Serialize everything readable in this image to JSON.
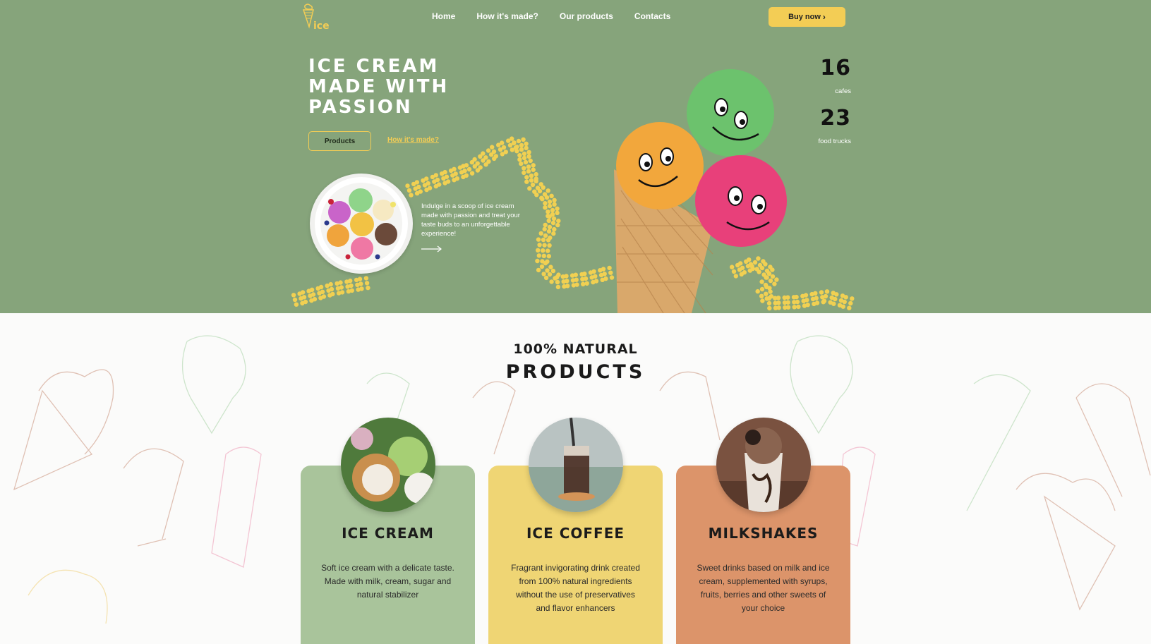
{
  "header": {
    "logo_text": "ice",
    "nav": [
      "Home",
      "How it's made?",
      "Our products",
      "Contacts"
    ],
    "buy_label": "Buy now",
    "buy_icon": "chevron-right-icon"
  },
  "hero": {
    "headline": [
      "ICE CREAM",
      "MADE WITH",
      "PASSION"
    ],
    "products_button": "Products",
    "how_link": "How it's made?",
    "intro_text": "Indulge in a scoop of ice cream made with passion and treat your taste buds to an unforgettable experience!",
    "stats": [
      {
        "value": "16",
        "label": "cafes"
      },
      {
        "value": "23",
        "label": "food trucks"
      }
    ]
  },
  "products": {
    "subtitle": "100% NATURAL",
    "title": "PRODUCTS",
    "cards": [
      {
        "title": "ICE CREAM",
        "desc": "Soft ice cream with a delicate taste. Made with milk, cream, sugar and natural stabilizer"
      },
      {
        "title": "ICE COFFEE",
        "desc": "Fragrant invigorating drink created from 100% natural ingredients without the use of preservatives and flavor enhancers"
      },
      {
        "title": "MILKSHAKES",
        "desc": "Sweet drinks based on milk and ice cream, supplemented with syrups, fruits, berries and other sweets of your choice"
      }
    ]
  },
  "colors": {
    "hero_bg": "#86a47b",
    "accent_yellow": "#f3cd55",
    "card_green": "#a9c49b",
    "card_yellow": "#efd574",
    "card_orange": "#dc946a"
  }
}
